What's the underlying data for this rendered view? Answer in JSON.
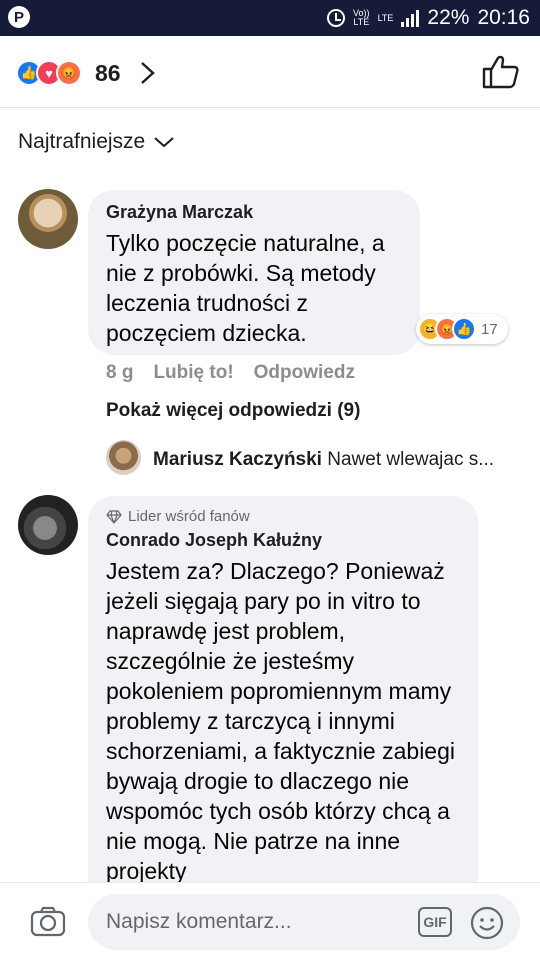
{
  "status_bar": {
    "volte_top": "Vo))",
    "volte_bottom": "LTE",
    "lte": "LTE",
    "battery": "22%",
    "time": "20:16"
  },
  "reactions": {
    "count": "86"
  },
  "sort_label": "Najtrafniejsze",
  "comments": [
    {
      "author": "Grażyna Marczak",
      "text": "Tylko poczęcie naturalne, a nie z probówki. Są metody leczenia trudności z poczęciem dziecka.",
      "reaction_count": "17",
      "time": "8 g",
      "like_label": "Lubię to!",
      "reply_label": "Odpowiedz",
      "more_replies": "Pokaż więcej odpowiedzi (9)",
      "reply_preview": {
        "author": "Mariusz Kaczyński",
        "text": "Nawet wlewajac s..."
      }
    },
    {
      "badge": "Lider wśród fanów",
      "author": "Conrado Joseph Kałużny",
      "text": "Jestem za? Dlaczego? Ponieważ jeżeli sięgają pary po in vitro to naprawdę jest problem, szczególnie że jesteśmy pokoleniem popromiennym mamy problemy z tarczycą i innymi schorzeniami, a faktycznie zabiegi bywają drogie to dlaczego nie wspomóc tych osób którzy chcą a nie mogą. Nie patrze na inne projekty"
    }
  ],
  "compose": {
    "placeholder": "Napisz komentarz...",
    "gif_label": "GIF"
  }
}
